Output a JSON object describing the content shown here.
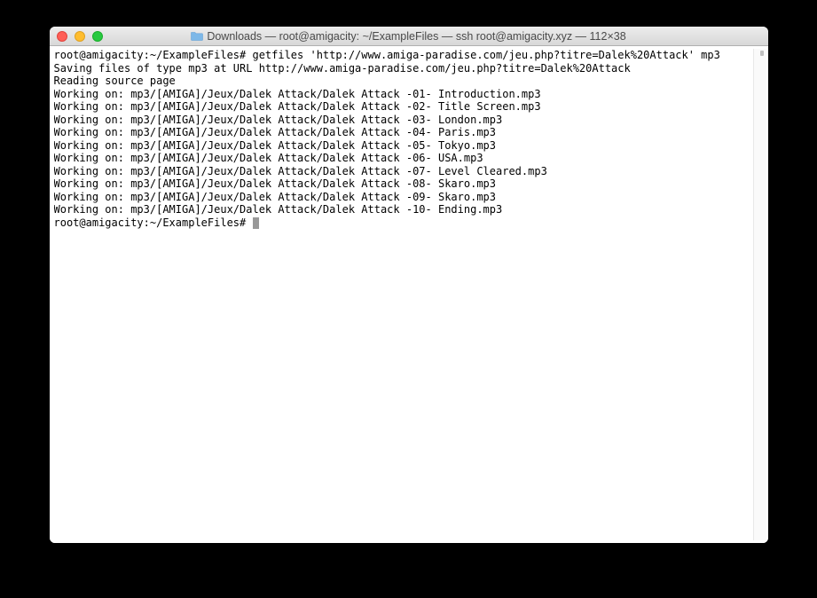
{
  "titlebar": {
    "title": "Downloads — root@amigacity: ~/ExampleFiles — ssh root@amigacity.xyz — 112×38"
  },
  "terminal": {
    "lines": [
      "root@amigacity:~/ExampleFiles# getfiles 'http://www.amiga-paradise.com/jeu.php?titre=Dalek%20Attack' mp3",
      "Saving files of type mp3 at URL http://www.amiga-paradise.com/jeu.php?titre=Dalek%20Attack",
      "Reading source page",
      "Working on: mp3/[AMIGA]/Jeux/Dalek Attack/Dalek Attack -01- Introduction.mp3",
      "Working on: mp3/[AMIGA]/Jeux/Dalek Attack/Dalek Attack -02- Title Screen.mp3",
      "Working on: mp3/[AMIGA]/Jeux/Dalek Attack/Dalek Attack -03- London.mp3",
      "Working on: mp3/[AMIGA]/Jeux/Dalek Attack/Dalek Attack -04- Paris.mp3",
      "Working on: mp3/[AMIGA]/Jeux/Dalek Attack/Dalek Attack -05- Tokyo.mp3",
      "Working on: mp3/[AMIGA]/Jeux/Dalek Attack/Dalek Attack -06- USA.mp3",
      "Working on: mp3/[AMIGA]/Jeux/Dalek Attack/Dalek Attack -07- Level Cleared.mp3",
      "Working on: mp3/[AMIGA]/Jeux/Dalek Attack/Dalek Attack -08- Skaro.mp3",
      "Working on: mp3/[AMIGA]/Jeux/Dalek Attack/Dalek Attack -09- Skaro.mp3",
      "Working on: mp3/[AMIGA]/Jeux/Dalek Attack/Dalek Attack -10- Ending.mp3"
    ],
    "prompt": "root@amigacity:~/ExampleFiles# "
  }
}
